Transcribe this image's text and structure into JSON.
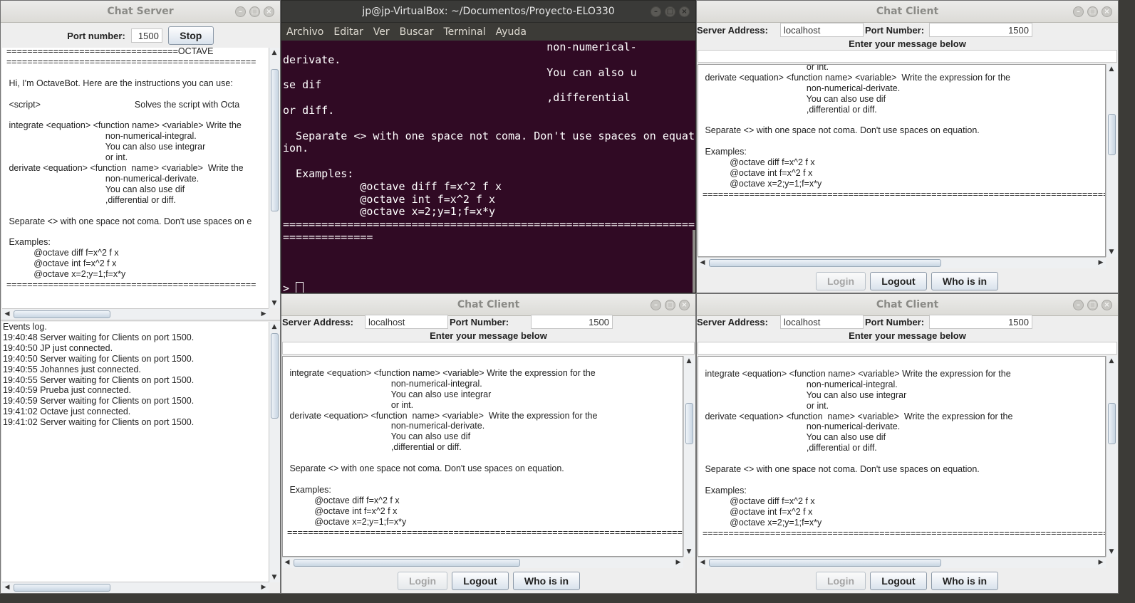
{
  "server": {
    "title": "Chat Server",
    "port_label": "Port number:",
    "port_value": "1500",
    "stop_label": "Stop",
    "chat_text": "=================================OCTAVE\n================================================\n\n Hi, I'm OctaveBot. Here are the instructions you can use:\n\n <script>                                      Solves the script with Octa\n\n integrate <equation> <function name> <variable> Write the\n                                        non-numerical-integral.\n                                        You can also use integrar\n                                        or int.\n derivate <equation> <function  name> <variable>  Write the\n                                        non-numerical-derivate.\n                                        You can also use dif\n                                        ,differential or diff.\n\n Separate <> with one space not coma. Don't use spaces on e\n\n Examples:\n           @octave diff f=x^2 f x\n           @octave int f=x^2 f x\n           @octave x=2;y=1;f=x*y\n================================================",
    "events_log": "Events log.\n19:40:48 Server waiting for Clients on port 1500.\n19:40:50 JP just connected.\n19:40:50 Server waiting for Clients on port 1500.\n19:40:55 Johannes just connected.\n19:40:55 Server waiting for Clients on port 1500.\n19:40:59 Prueba just connected.\n19:40:59 Server waiting for Clients on port 1500.\n19:41:02 Octave just connected.\n19:41:02 Server waiting for Clients on port 1500."
  },
  "terminal": {
    "title": "jp@jp-VirtualBox: ~/Documentos/Proyecto-ELO330",
    "menu": [
      "Archivo",
      "Editar",
      "Ver",
      "Buscar",
      "Terminal",
      "Ayuda"
    ],
    "text": "                                         non-numerical-\nderivate.\n                                         You can also u\nse dif\n                                         ,differential \nor diff.\n\n  Separate <> with one space not coma. Don't use spaces on equat\nion.\n\n  Examples:\n            @octave diff f=x^2 f x\n            @octave int f=x^2 f x\n            @octave x=2;y=1;f=x*y\n================================================================\n==============\n\n\n\n> "
  },
  "client_common": {
    "title": "Chat Client",
    "server_address_label": "Server Address:",
    "server_address_value": "localhost",
    "port_label": "Port Number:",
    "port_value": "1500",
    "message_prompt": "Enter your message below",
    "login_label": "Login",
    "logout_label": "Logout",
    "whoisin_label": "Who is in"
  },
  "client_top": {
    "chat_text": "                                          or int.\n derivate <equation> <function name> <variable>  Write the expression for the\n                                          non-numerical-derivate.\n                                          You can also use dif\n                                          ,differential or diff.\n\n Separate <> with one space not coma. Don't use spaces on equation.\n\n Examples:\n           @octave diff f=x^2 f x\n           @octave int f=x^2 f x\n           @octave x=2;y=1;f=x*y\n======================================================================================"
  },
  "client_bottom": {
    "chat_text": "\n integrate <equation> <function name> <variable> Write the expression for the\n                                          non-numerical-integral.\n                                          You can also use integrar\n                                          or int.\n derivate <equation> <function  name> <variable>  Write the expression for the\n                                          non-numerical-derivate.\n                                          You can also use dif\n                                          ,differential or diff.\n\n Separate <> with one space not coma. Don't use spaces on equation.\n\n Examples:\n           @octave diff f=x^2 f x\n           @octave int f=x^2 f x\n           @octave x=2;y=1;f=x*y\n======================================================================================"
  }
}
